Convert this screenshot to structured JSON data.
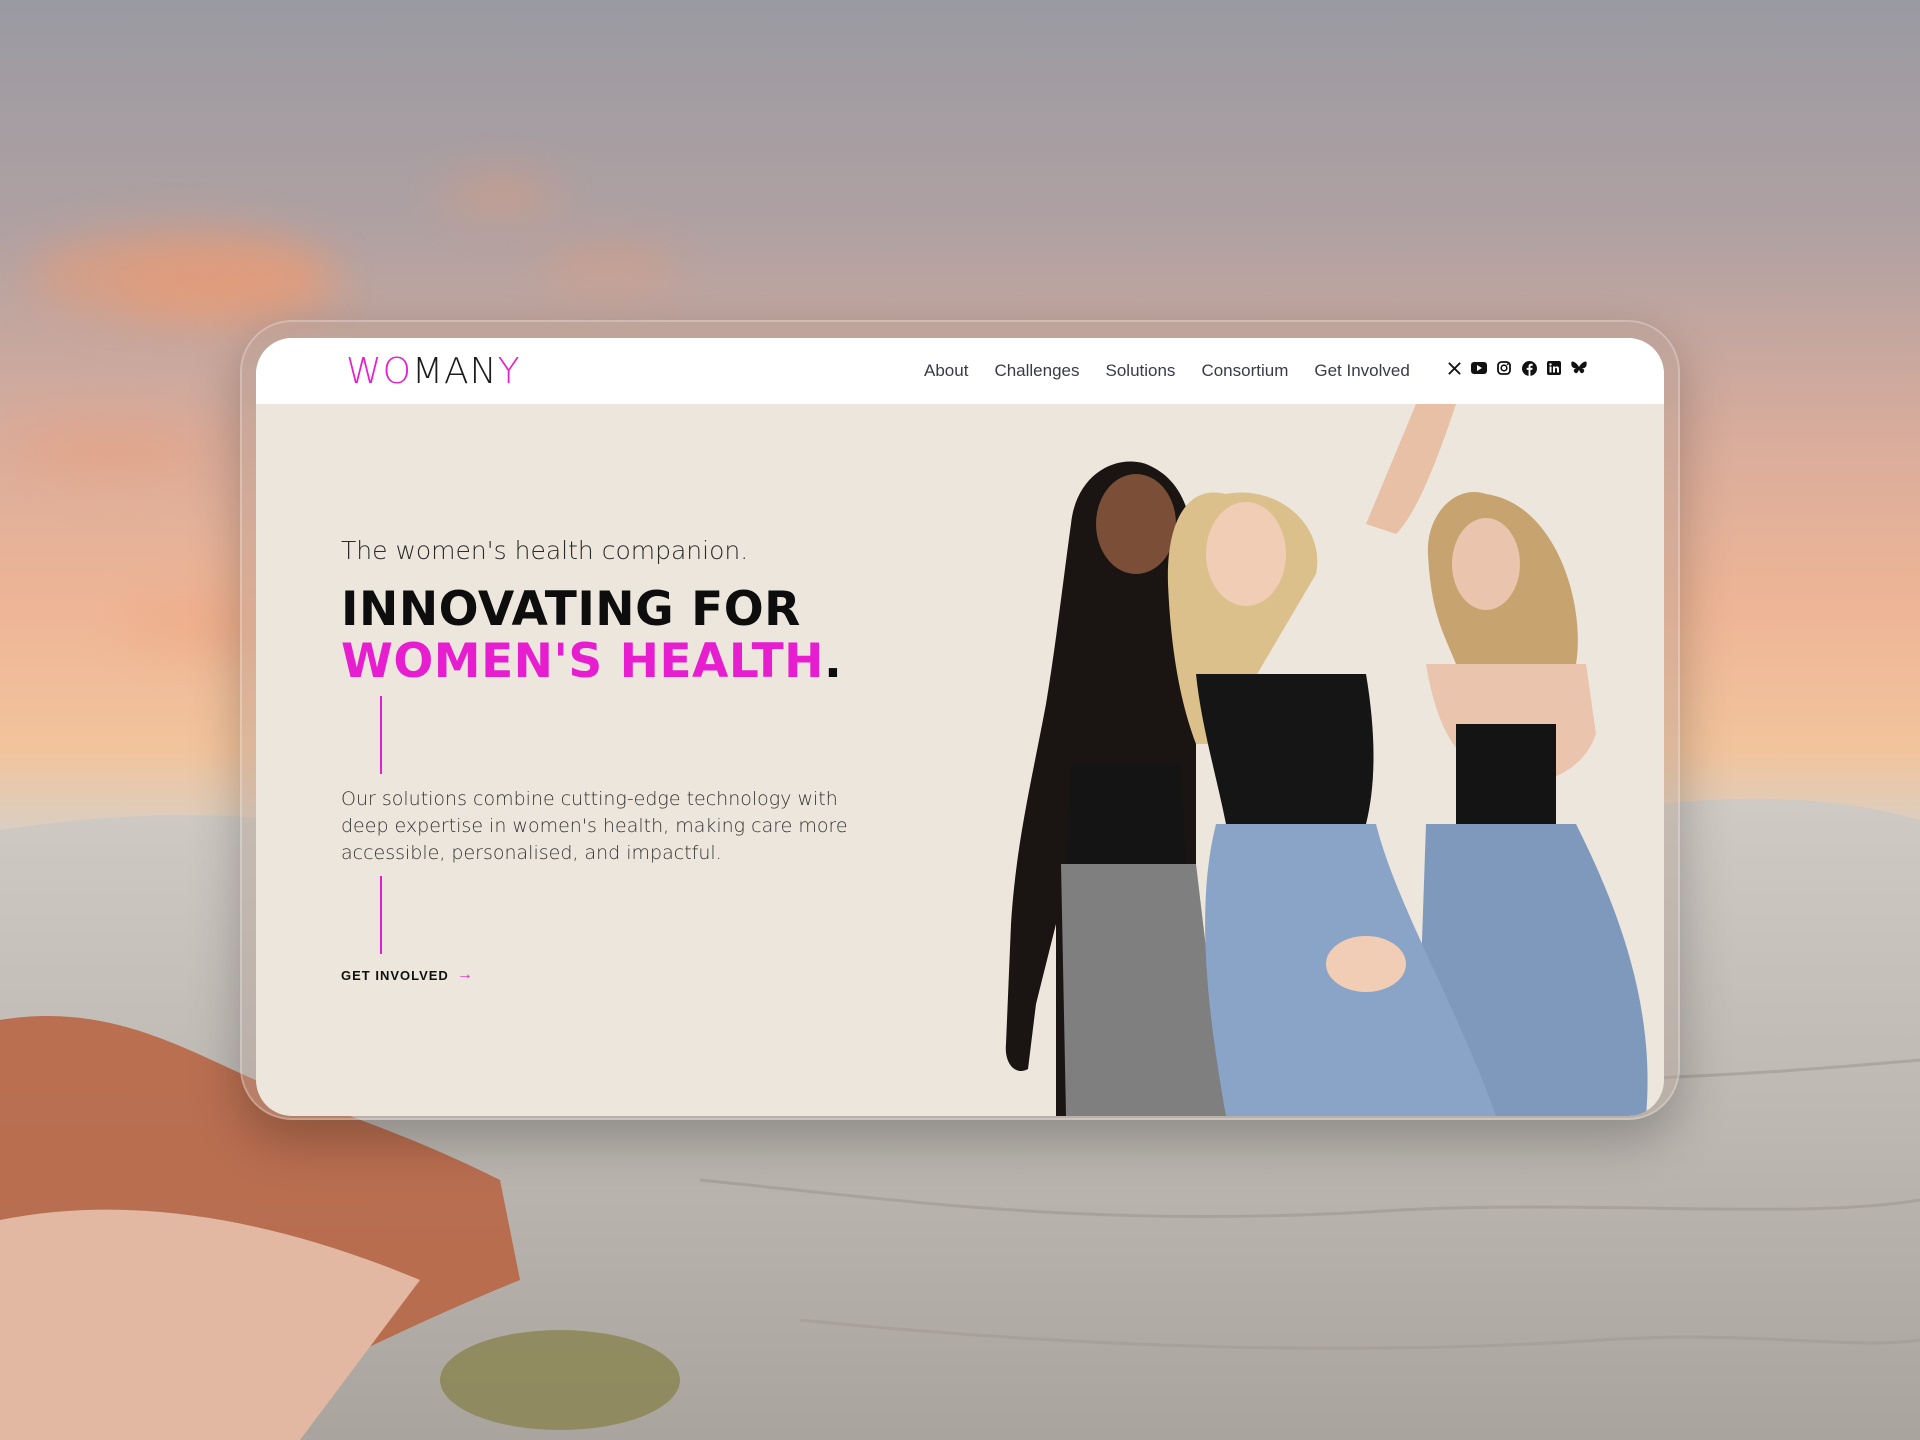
{
  "brand": {
    "logo_part1": "WO",
    "logo_part2": "MAN",
    "logo_part3": "Y",
    "accent_color": "#e61ecf"
  },
  "nav": {
    "items": [
      {
        "label": "About"
      },
      {
        "label": "Challenges"
      },
      {
        "label": "Solutions"
      },
      {
        "label": "Consortium"
      },
      {
        "label": "Get Involved"
      }
    ],
    "social_icons": [
      "x-icon",
      "youtube-icon",
      "instagram-icon",
      "facebook-icon",
      "linkedin-icon",
      "bluesky-icon"
    ]
  },
  "hero": {
    "tagline": "The women's health companion.",
    "headline_line1": "INNOVATING FOR",
    "headline_line2_accent": "WOMEN'S HEALTH",
    "headline_period": ".",
    "description": "Our solutions combine cutting-edge technology with deep expertise in women's health, making care more accessible, personalised, and impactful.",
    "cta_label": "GET INVOLVED",
    "cta_arrow": "→",
    "image_subject": "three women in black tops and jeans"
  }
}
